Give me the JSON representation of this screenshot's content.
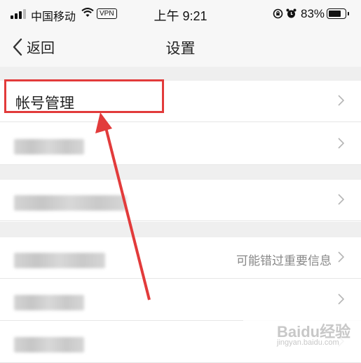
{
  "status_bar": {
    "carrier": "中国移动",
    "vpn": "VPN",
    "time": "上午 9:21",
    "battery_pct": "83%",
    "battery_level": 0.83
  },
  "nav": {
    "back_label": "返回",
    "title": "设置"
  },
  "rows": [
    {
      "label": "帐号管理",
      "value": ""
    },
    {
      "label": "",
      "value": ""
    },
    {
      "label": "",
      "value": ""
    },
    {
      "label": "",
      "value": "可能错过重要信息"
    },
    {
      "label": "",
      "value": ""
    },
    {
      "label": "",
      "value": ""
    }
  ],
  "watermark": {
    "text": "Baidu经验",
    "sub": "jingyan.baidu.com"
  },
  "colors": {
    "highlight": "#e23b3b",
    "background": "#efefef"
  }
}
